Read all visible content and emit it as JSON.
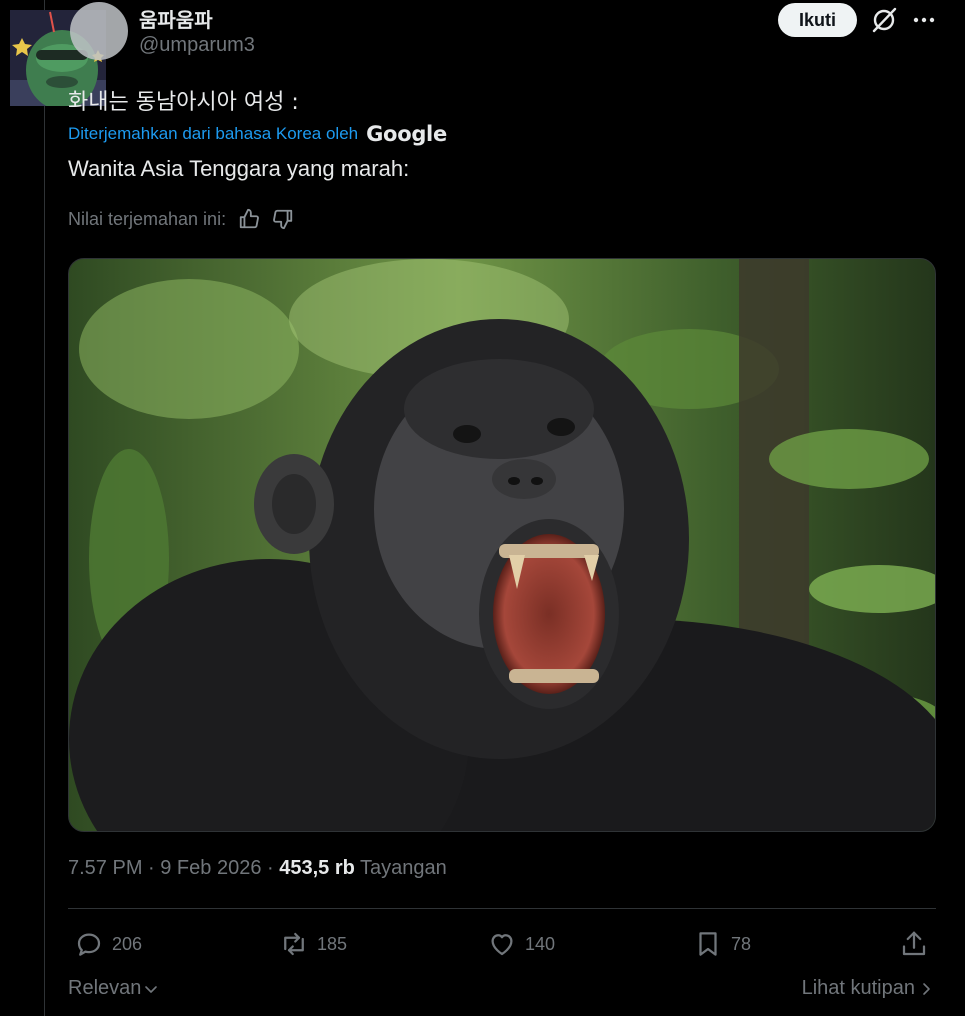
{
  "tweet": {
    "display_name": "움파움파",
    "handle": "@umparum3",
    "follow_label": "Ikuti",
    "original_text": "화내는 동남아시아 여성 :",
    "translated_by_label": "Diterjemahkan dari bahasa Korea oleh",
    "translator_brand": "Google",
    "translated_text": "Wanita Asia Tenggara yang marah:",
    "rate_translation_label": "Nilai terjemahan ini:",
    "timestamp": "7.57 PM · 9 Feb 2026 · ",
    "views_count": "453,5 rb",
    "views_label": " Tayangan"
  },
  "actions": {
    "replies": "206",
    "reposts": "185",
    "likes": "140",
    "bookmarks": "78"
  },
  "footer": {
    "sort_label": "Relevan",
    "quotes_label": "Lihat kutipan"
  },
  "icons": [
    "grok-icon",
    "more-icon",
    "thumbs-up-icon",
    "thumbs-down-icon",
    "reply-icon",
    "repost-icon",
    "like-icon",
    "bookmark-icon",
    "share-icon",
    "chevron-down-icon",
    "chevron-right-icon"
  ],
  "colors": {
    "background": "#000000",
    "text_primary": "#e7e9ea",
    "text_secondary": "#71767b",
    "link": "#1d9bf0",
    "follow_button_bg": "#eff3f4",
    "divider": "#2f3336"
  }
}
